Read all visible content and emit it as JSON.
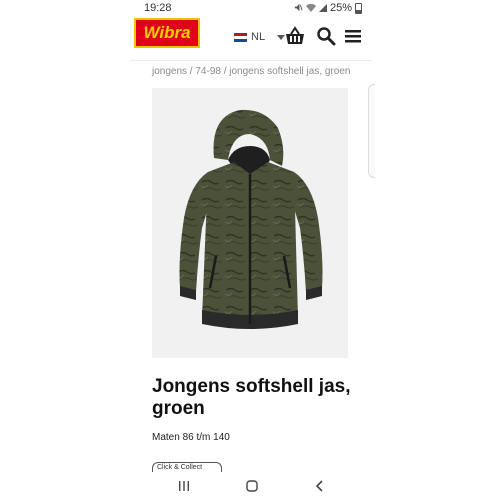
{
  "status_bar": {
    "time": "19:28",
    "battery": "25%",
    "icons": [
      "mute-icon",
      "wifi-icon",
      "signal-icon",
      "battery-icon"
    ]
  },
  "header": {
    "logo": "Wibra",
    "language": "NL",
    "flag_colors": [
      "#ae1c28",
      "#ffffff",
      "#21468b"
    ],
    "icons": [
      "basket-icon",
      "search-icon",
      "menu-icon"
    ]
  },
  "breadcrumb": "jongens / 74-98 / jongens softshell jas, groen",
  "product": {
    "title": "Jongens softshell jas, groen",
    "sizes": "Maten 86 t/m 140",
    "chip_label": "Click & Collect"
  },
  "colors": {
    "brand_red": "#e3001b",
    "brand_yellow": "#f5d000",
    "jacket_green": "#4a4f37"
  }
}
